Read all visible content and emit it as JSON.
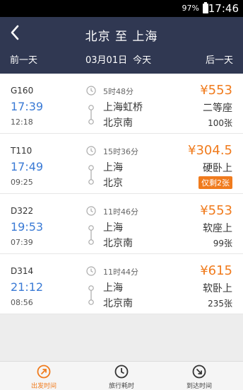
{
  "status_bar": {
    "battery": "97%",
    "time": "17:46"
  },
  "header": {
    "title": "北京 至 上海",
    "prev_day": "前一天",
    "date": "03月01日",
    "day_label": "今天",
    "next_day": "后一天"
  },
  "trains": [
    {
      "code": "G160",
      "depart": "17:39",
      "arrive": "12:18",
      "duration": "5时48分",
      "from": "上海虹桥",
      "to": "北京南",
      "price": "¥553",
      "seat": "二等座",
      "tickets": "100张",
      "warning": ""
    },
    {
      "code": "T110",
      "depart": "17:49",
      "arrive": "09:25",
      "duration": "15时36分",
      "from": "上海",
      "to": "北京",
      "price": "¥304.5",
      "seat": "硬卧上",
      "tickets": "",
      "warning": "仅剩2张"
    },
    {
      "code": "D322",
      "depart": "19:53",
      "arrive": "07:39",
      "duration": "11时46分",
      "from": "上海",
      "to": "北京南",
      "price": "¥553",
      "seat": "软座上",
      "tickets": "99张",
      "warning": ""
    },
    {
      "code": "D314",
      "depart": "21:12",
      "arrive": "08:56",
      "duration": "11时44分",
      "from": "上海",
      "to": "北京南",
      "price": "¥615",
      "seat": "软卧上",
      "tickets": "235张",
      "warning": ""
    }
  ],
  "tabs": {
    "depart_time": "出发时间",
    "travel_time": "旅行耗时",
    "arrive_time": "到达时间"
  },
  "colors": {
    "header_bg": "#303852",
    "accent": "#f07b1d",
    "time_blue": "#3a7ad5"
  }
}
